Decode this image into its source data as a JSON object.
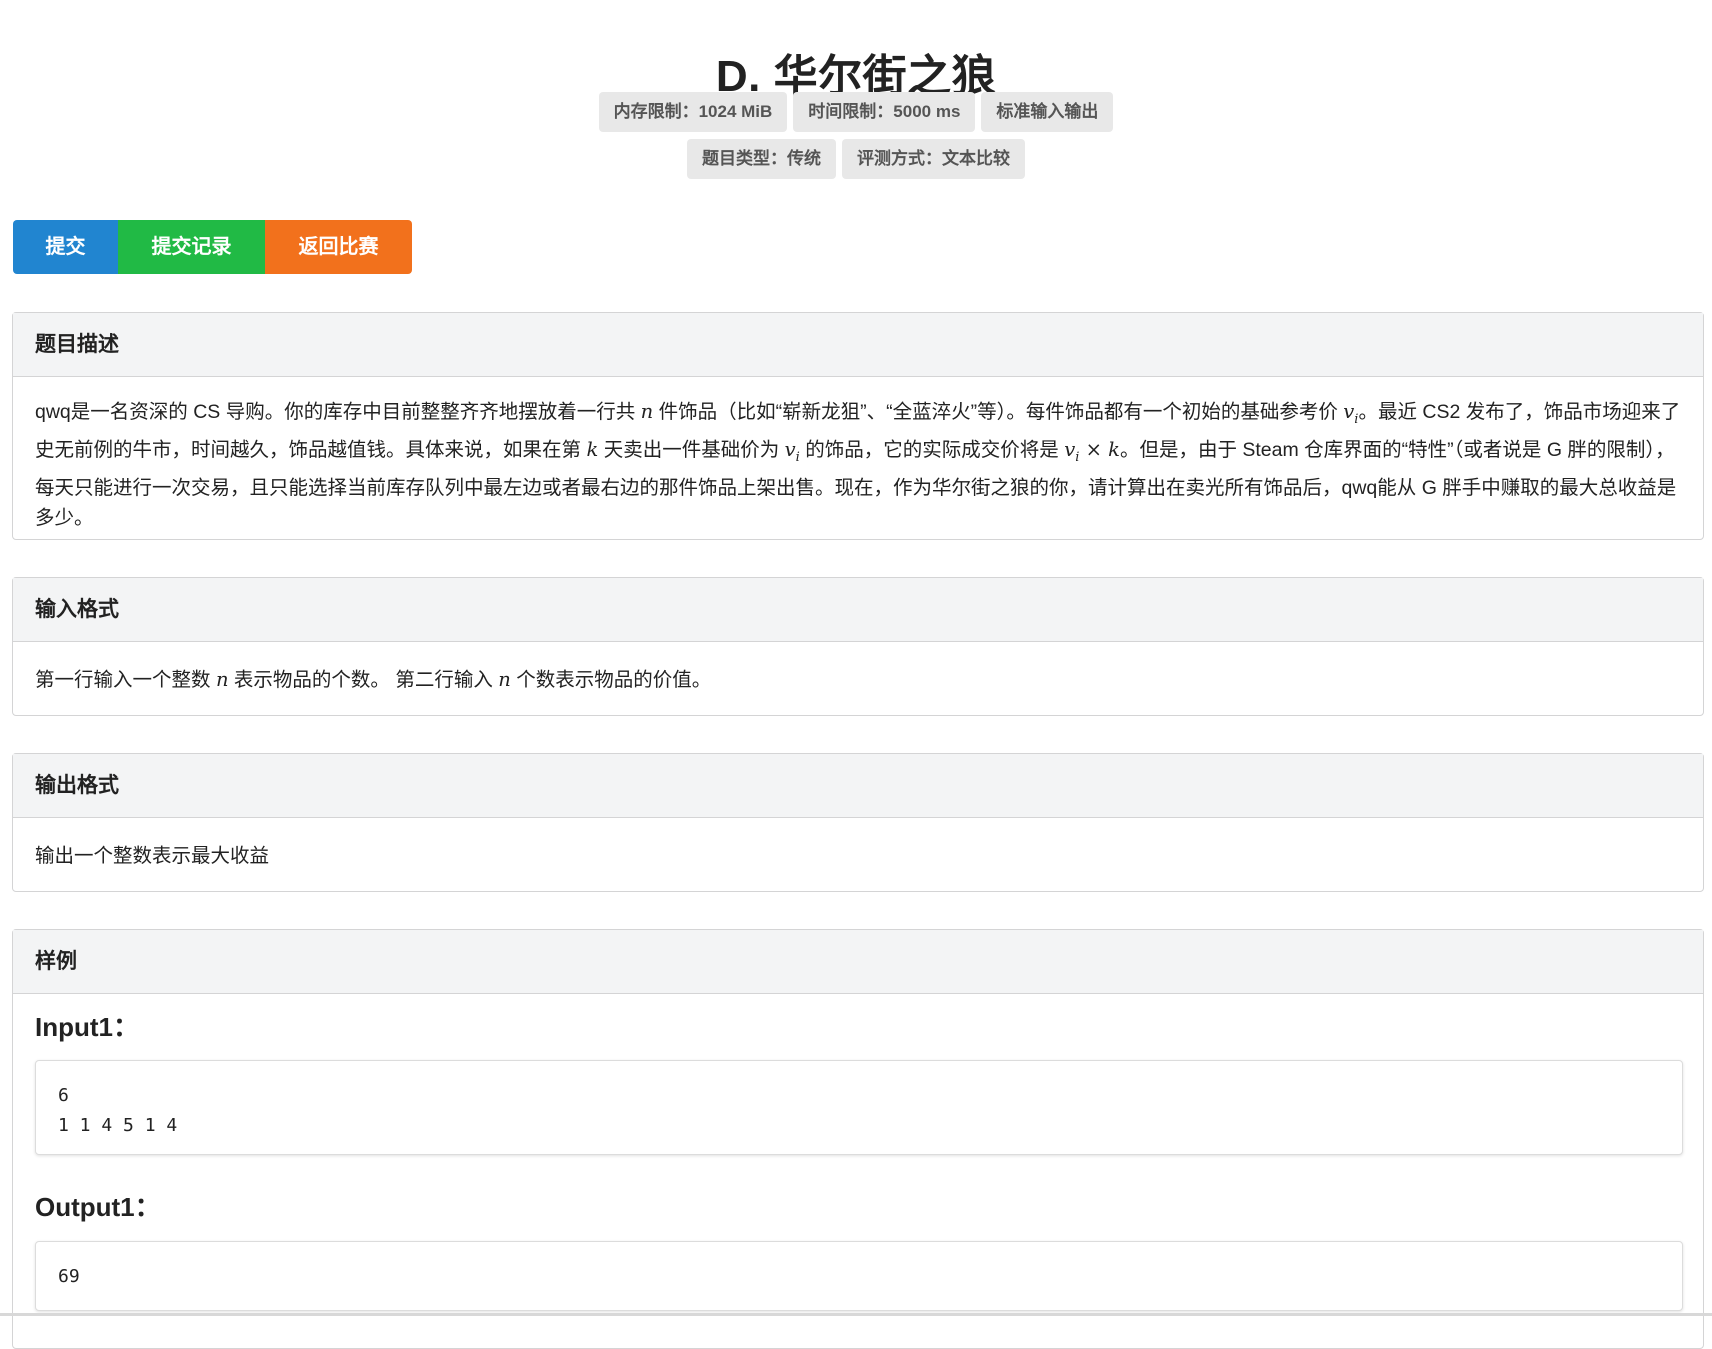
{
  "problem": {
    "title": "D. 华尔街之狼"
  },
  "meta": {
    "memory_limit": "内存限制：1024 MiB",
    "time_limit": "时间限制：5000 ms",
    "io": "标准输入输出",
    "type": "题目类型：传统",
    "judge": "评测方式：文本比较"
  },
  "buttons": {
    "submit": "提交",
    "records": "提交记录",
    "back": "返回比赛"
  },
  "sections": {
    "description": {
      "title": "题目描述",
      "p1": "qwq是一名资深的 CS 导购。你的库存中目前整整齐齐地摆放着一行共",
      "p2": "件饰品（比如“崭新龙狙”、“全蓝淬火”等）。每件饰品都有一个初始的基础参考价",
      "p3": "。最近 CS2 发布了，饰品市场迎来了史无前例的牛市，时间越久，饰品越值钱。具体来说，如果在第",
      "p4": "天卖出一件基础价为",
      "p5": "的饰品，它的实际成交价将是",
      "p6": "。但是，由于 Steam 仓库界面的“特性”（或者说是 G 胖的限制），每天只能进行一次交易，且只能选择当前库存队列中最左边或者最右边的那件饰品上架出售。现在，作为华尔街之狼的你，请计算出在卖光所有饰品后，qwq能从 G 胖手中赚取的最大总收益是多少。"
    },
    "input": {
      "title": "输入格式",
      "p1": "第一行输入一个整数",
      "p2": "表示物品的个数。 第二行输入",
      "p3": "个数表示物品的价值。"
    },
    "output": {
      "title": "输出格式",
      "text": "输出一个整数表示最大收益"
    },
    "sample": {
      "title": "样例",
      "input_label": "Input1：",
      "input_text": "6\n1 1 4 5 1 4",
      "output_label": "Output1：",
      "output_text": "69"
    }
  },
  "math": {
    "n": "n",
    "v": "v",
    "i": "i",
    "k": "k",
    "times": "×"
  }
}
